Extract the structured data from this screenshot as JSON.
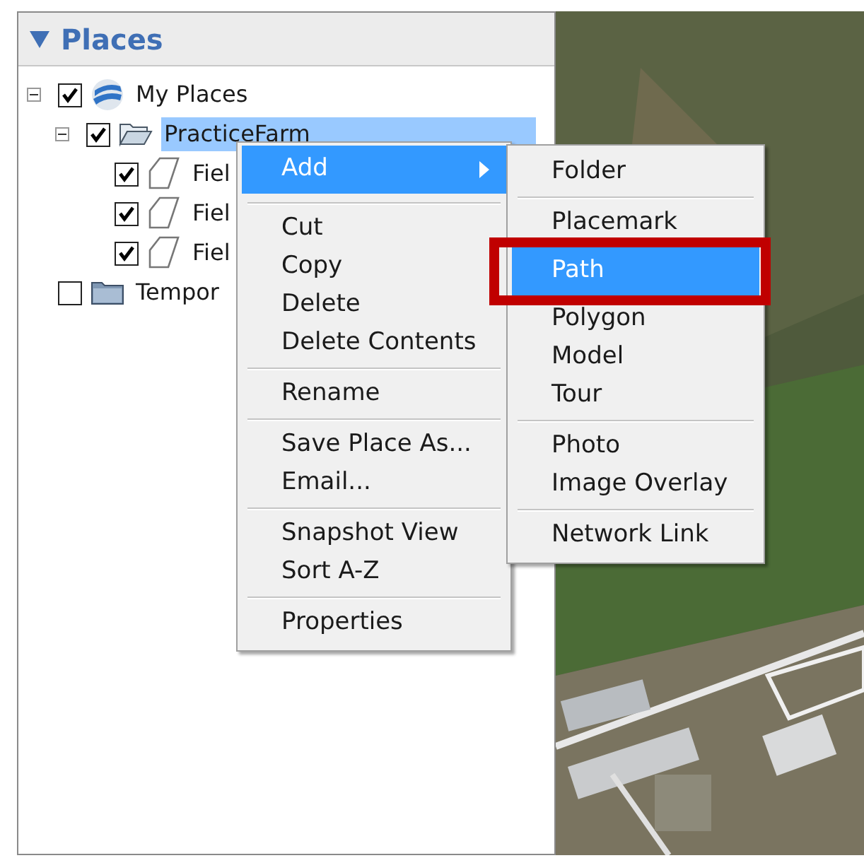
{
  "panel": {
    "title": "Places",
    "expanded": true
  },
  "tree": [
    {
      "label": "My Places",
      "kind": "root",
      "checked": true,
      "expanded": true,
      "selected": false,
      "children": [
        {
          "label": "PracticeFarm",
          "kind": "folder",
          "checked": true,
          "expanded": true,
          "selected": true,
          "children": [
            {
              "label": "Fiel",
              "kind": "polygon",
              "checked": true,
              "selected": false
            },
            {
              "label": "Fiel",
              "kind": "polygon",
              "checked": true,
              "selected": false
            },
            {
              "label": "Fiel",
              "kind": "polygon",
              "checked": true,
              "selected": false
            }
          ]
        }
      ]
    },
    {
      "label": "Tempor",
      "kind": "folder",
      "checked": false,
      "selected": false
    }
  ],
  "context_menu": [
    {
      "kind": "item",
      "label": "Add",
      "submenu": true,
      "selected": true
    },
    {
      "kind": "separator"
    },
    {
      "kind": "item",
      "label": "Cut",
      "selected": false
    },
    {
      "kind": "item",
      "label": "Copy",
      "selected": false
    },
    {
      "kind": "item",
      "label": "Delete",
      "selected": false
    },
    {
      "kind": "item",
      "label": "Delete Contents",
      "selected": false
    },
    {
      "kind": "separator"
    },
    {
      "kind": "item",
      "label": "Rename",
      "selected": false
    },
    {
      "kind": "separator"
    },
    {
      "kind": "item",
      "label": "Save Place As...",
      "selected": false
    },
    {
      "kind": "item",
      "label": "Email...",
      "selected": false
    },
    {
      "kind": "separator"
    },
    {
      "kind": "item",
      "label": "Snapshot View",
      "selected": false
    },
    {
      "kind": "item",
      "label": "Sort A-Z",
      "selected": false
    },
    {
      "kind": "separator"
    },
    {
      "kind": "item",
      "label": "Properties",
      "selected": false
    }
  ],
  "submenu": [
    {
      "kind": "item",
      "label": "Folder",
      "selected": false,
      "highlighted": false
    },
    {
      "kind": "separator"
    },
    {
      "kind": "item",
      "label": "Placemark",
      "selected": false,
      "highlighted": false
    },
    {
      "kind": "item",
      "label": "Path",
      "selected": true,
      "highlighted": true
    },
    {
      "kind": "item",
      "label": "Polygon",
      "selected": false,
      "highlighted": false
    },
    {
      "kind": "item",
      "label": "Model",
      "selected": false,
      "highlighted": false
    },
    {
      "kind": "item",
      "label": "Tour",
      "selected": false,
      "highlighted": false
    },
    {
      "kind": "separator"
    },
    {
      "kind": "item",
      "label": "Photo",
      "selected": false,
      "highlighted": false
    },
    {
      "kind": "item",
      "label": "Image Overlay",
      "selected": false,
      "highlighted": false
    },
    {
      "kind": "separator"
    },
    {
      "kind": "item",
      "label": "Network Link",
      "selected": false,
      "highlighted": false
    }
  ]
}
